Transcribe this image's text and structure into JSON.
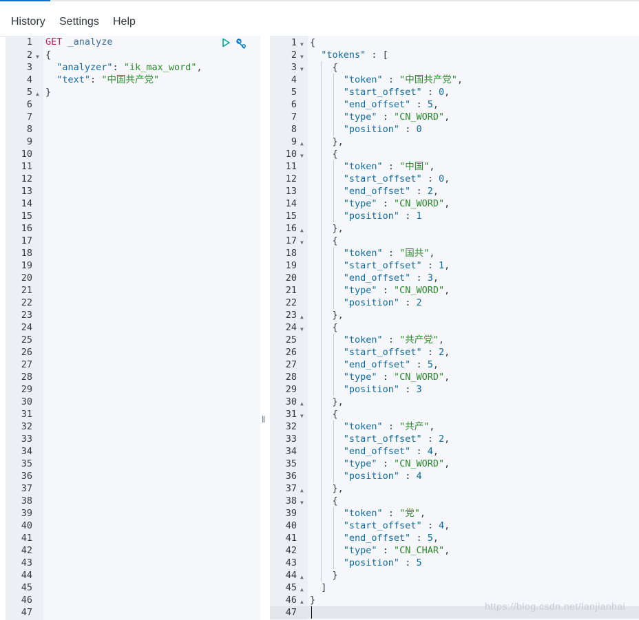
{
  "menu": {
    "history": "History",
    "settings": "Settings",
    "help": "Help"
  },
  "request": {
    "method": "GET",
    "endpoint": "_analyze",
    "lines": [
      [
        [
          "p",
          "{"
        ]
      ],
      [
        [
          "p",
          "  "
        ],
        [
          "k",
          "\"analyzer\""
        ],
        [
          "p",
          ": "
        ],
        [
          "s",
          "\"ik_max_word\""
        ],
        [
          "p",
          ","
        ]
      ],
      [
        [
          "p",
          "  "
        ],
        [
          "k",
          "\"text\""
        ],
        [
          "p",
          ": "
        ],
        [
          "s",
          "\"中国共产党\""
        ]
      ],
      [
        [
          "p",
          "}"
        ]
      ]
    ],
    "total_lines": 47
  },
  "response": {
    "lines": [
      [
        [
          "p",
          "{"
        ]
      ],
      [
        [
          "p",
          "  "
        ],
        [
          "k",
          "\"tokens\""
        ],
        [
          "p",
          " : ["
        ]
      ],
      [
        [
          "p",
          "    {"
        ]
      ],
      [
        [
          "p",
          "      "
        ],
        [
          "k",
          "\"token\""
        ],
        [
          "p",
          " : "
        ],
        [
          "s",
          "\"中国共产党\""
        ],
        [
          "p",
          ","
        ]
      ],
      [
        [
          "p",
          "      "
        ],
        [
          "k",
          "\"start_offset\""
        ],
        [
          "p",
          " : "
        ],
        [
          "n",
          "0"
        ],
        [
          "p",
          ","
        ]
      ],
      [
        [
          "p",
          "      "
        ],
        [
          "k",
          "\"end_offset\""
        ],
        [
          "p",
          " : "
        ],
        [
          "n",
          "5"
        ],
        [
          "p",
          ","
        ]
      ],
      [
        [
          "p",
          "      "
        ],
        [
          "k",
          "\"type\""
        ],
        [
          "p",
          " : "
        ],
        [
          "s",
          "\"CN_WORD\""
        ],
        [
          "p",
          ","
        ]
      ],
      [
        [
          "p",
          "      "
        ],
        [
          "k",
          "\"position\""
        ],
        [
          "p",
          " : "
        ],
        [
          "n",
          "0"
        ]
      ],
      [
        [
          "p",
          "    },"
        ]
      ],
      [
        [
          "p",
          "    {"
        ]
      ],
      [
        [
          "p",
          "      "
        ],
        [
          "k",
          "\"token\""
        ],
        [
          "p",
          " : "
        ],
        [
          "s",
          "\"中国\""
        ],
        [
          "p",
          ","
        ]
      ],
      [
        [
          "p",
          "      "
        ],
        [
          "k",
          "\"start_offset\""
        ],
        [
          "p",
          " : "
        ],
        [
          "n",
          "0"
        ],
        [
          "p",
          ","
        ]
      ],
      [
        [
          "p",
          "      "
        ],
        [
          "k",
          "\"end_offset\""
        ],
        [
          "p",
          " : "
        ],
        [
          "n",
          "2"
        ],
        [
          "p",
          ","
        ]
      ],
      [
        [
          "p",
          "      "
        ],
        [
          "k",
          "\"type\""
        ],
        [
          "p",
          " : "
        ],
        [
          "s",
          "\"CN_WORD\""
        ],
        [
          "p",
          ","
        ]
      ],
      [
        [
          "p",
          "      "
        ],
        [
          "k",
          "\"position\""
        ],
        [
          "p",
          " : "
        ],
        [
          "n",
          "1"
        ]
      ],
      [
        [
          "p",
          "    },"
        ]
      ],
      [
        [
          "p",
          "    {"
        ]
      ],
      [
        [
          "p",
          "      "
        ],
        [
          "k",
          "\"token\""
        ],
        [
          "p",
          " : "
        ],
        [
          "s",
          "\"国共\""
        ],
        [
          "p",
          ","
        ]
      ],
      [
        [
          "p",
          "      "
        ],
        [
          "k",
          "\"start_offset\""
        ],
        [
          "p",
          " : "
        ],
        [
          "n",
          "1"
        ],
        [
          "p",
          ","
        ]
      ],
      [
        [
          "p",
          "      "
        ],
        [
          "k",
          "\"end_offset\""
        ],
        [
          "p",
          " : "
        ],
        [
          "n",
          "3"
        ],
        [
          "p",
          ","
        ]
      ],
      [
        [
          "p",
          "      "
        ],
        [
          "k",
          "\"type\""
        ],
        [
          "p",
          " : "
        ],
        [
          "s",
          "\"CN_WORD\""
        ],
        [
          "p",
          ","
        ]
      ],
      [
        [
          "p",
          "      "
        ],
        [
          "k",
          "\"position\""
        ],
        [
          "p",
          " : "
        ],
        [
          "n",
          "2"
        ]
      ],
      [
        [
          "p",
          "    },"
        ]
      ],
      [
        [
          "p",
          "    {"
        ]
      ],
      [
        [
          "p",
          "      "
        ],
        [
          "k",
          "\"token\""
        ],
        [
          "p",
          " : "
        ],
        [
          "s",
          "\"共产党\""
        ],
        [
          "p",
          ","
        ]
      ],
      [
        [
          "p",
          "      "
        ],
        [
          "k",
          "\"start_offset\""
        ],
        [
          "p",
          " : "
        ],
        [
          "n",
          "2"
        ],
        [
          "p",
          ","
        ]
      ],
      [
        [
          "p",
          "      "
        ],
        [
          "k",
          "\"end_offset\""
        ],
        [
          "p",
          " : "
        ],
        [
          "n",
          "5"
        ],
        [
          "p",
          ","
        ]
      ],
      [
        [
          "p",
          "      "
        ],
        [
          "k",
          "\"type\""
        ],
        [
          "p",
          " : "
        ],
        [
          "s",
          "\"CN_WORD\""
        ],
        [
          "p",
          ","
        ]
      ],
      [
        [
          "p",
          "      "
        ],
        [
          "k",
          "\"position\""
        ],
        [
          "p",
          " : "
        ],
        [
          "n",
          "3"
        ]
      ],
      [
        [
          "p",
          "    },"
        ]
      ],
      [
        [
          "p",
          "    {"
        ]
      ],
      [
        [
          "p",
          "      "
        ],
        [
          "k",
          "\"token\""
        ],
        [
          "p",
          " : "
        ],
        [
          "s",
          "\"共产\""
        ],
        [
          "p",
          ","
        ]
      ],
      [
        [
          "p",
          "      "
        ],
        [
          "k",
          "\"start_offset\""
        ],
        [
          "p",
          " : "
        ],
        [
          "n",
          "2"
        ],
        [
          "p",
          ","
        ]
      ],
      [
        [
          "p",
          "      "
        ],
        [
          "k",
          "\"end_offset\""
        ],
        [
          "p",
          " : "
        ],
        [
          "n",
          "4"
        ],
        [
          "p",
          ","
        ]
      ],
      [
        [
          "p",
          "      "
        ],
        [
          "k",
          "\"type\""
        ],
        [
          "p",
          " : "
        ],
        [
          "s",
          "\"CN_WORD\""
        ],
        [
          "p",
          ","
        ]
      ],
      [
        [
          "p",
          "      "
        ],
        [
          "k",
          "\"position\""
        ],
        [
          "p",
          " : "
        ],
        [
          "n",
          "4"
        ]
      ],
      [
        [
          "p",
          "    },"
        ]
      ],
      [
        [
          "p",
          "    {"
        ]
      ],
      [
        [
          "p",
          "      "
        ],
        [
          "k",
          "\"token\""
        ],
        [
          "p",
          " : "
        ],
        [
          "s",
          "\"党\""
        ],
        [
          "p",
          ","
        ]
      ],
      [
        [
          "p",
          "      "
        ],
        [
          "k",
          "\"start_offset\""
        ],
        [
          "p",
          " : "
        ],
        [
          "n",
          "4"
        ],
        [
          "p",
          ","
        ]
      ],
      [
        [
          "p",
          "      "
        ],
        [
          "k",
          "\"end_offset\""
        ],
        [
          "p",
          " : "
        ],
        [
          "n",
          "5"
        ],
        [
          "p",
          ","
        ]
      ],
      [
        [
          "p",
          "      "
        ],
        [
          "k",
          "\"type\""
        ],
        [
          "p",
          " : "
        ],
        [
          "s",
          "\"CN_CHAR\""
        ],
        [
          "p",
          ","
        ]
      ],
      [
        [
          "p",
          "      "
        ],
        [
          "k",
          "\"position\""
        ],
        [
          "p",
          " : "
        ],
        [
          "n",
          "5"
        ]
      ],
      [
        [
          "p",
          "    }"
        ]
      ],
      [
        [
          "p",
          "  ]"
        ]
      ],
      [
        [
          "p",
          "}"
        ]
      ],
      []
    ],
    "fold_open": [
      1,
      2,
      3,
      10,
      17,
      24,
      31,
      38
    ],
    "fold_close": [
      9,
      16,
      23,
      30,
      37,
      44,
      45,
      46
    ]
  },
  "icons": {
    "run": "play-icon",
    "wrench": "wrench-icon",
    "splitter": "resize-handle-icon"
  },
  "colors": {
    "accent": "#0077cc",
    "string": "#2a8a2a",
    "key": "#0e6aa0",
    "method": "#c61e5a"
  },
  "watermark": "https://blog.csdn.net/lanjianhai"
}
